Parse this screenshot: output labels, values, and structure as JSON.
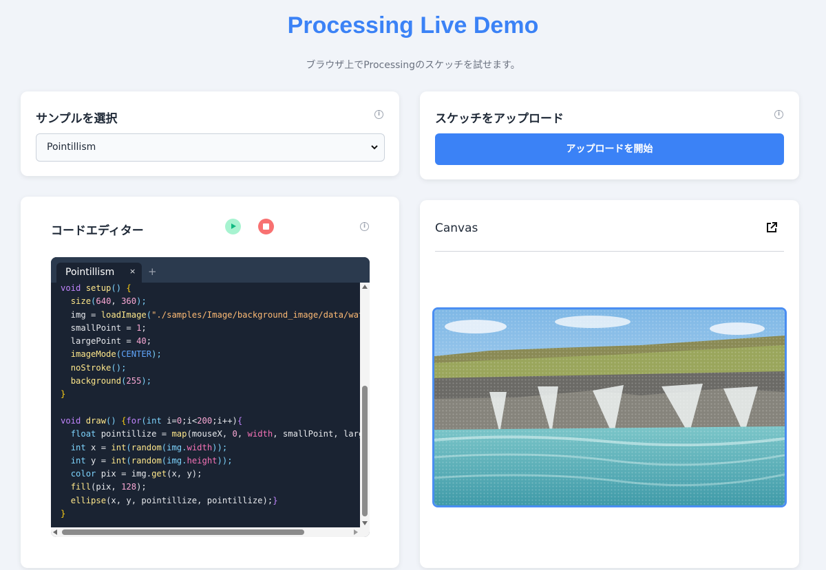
{
  "header": {
    "title": "Processing Live Demo",
    "subtitle": "ブラウザ上でProcessingのスケッチを試せます。"
  },
  "sample_card": {
    "title": "サンプルを選択",
    "selected": "Pointillism"
  },
  "upload_card": {
    "title": "スケッチをアップロード",
    "button_label": "アップロードを開始"
  },
  "editor_card": {
    "title": "コードエディター",
    "tab_label": "Pointillism",
    "tab_close": "×",
    "tab_add": "+"
  },
  "canvas_card": {
    "title": "Canvas"
  },
  "code": [
    [
      [
        "void ",
        "kw"
      ],
      [
        "setup",
        "fn"
      ],
      [
        "() ",
        "ty"
      ],
      [
        "{",
        "br"
      ]
    ],
    [
      [
        "  "
      ],
      [
        "size",
        "fn"
      ],
      [
        "(",
        "ty"
      ],
      [
        "640",
        "num"
      ],
      [
        ", "
      ],
      [
        "360",
        "num"
      ],
      [
        ");",
        "ty"
      ]
    ],
    [
      [
        "  img = "
      ],
      [
        "loadImage",
        "fn"
      ],
      [
        "(",
        "ty"
      ],
      [
        "\"./samples/Image/background_image/data/water",
        "str"
      ]
    ],
    [
      [
        "  smallPoint = "
      ],
      [
        "1",
        "num"
      ],
      [
        ";"
      ]
    ],
    [
      [
        "  largePoint = "
      ],
      [
        "40",
        "num"
      ],
      [
        ";"
      ]
    ],
    [
      [
        "  "
      ],
      [
        "imageMode",
        "fn"
      ],
      [
        "(",
        "ty"
      ],
      [
        "CENTER",
        "cn"
      ],
      [
        ");",
        "ty"
      ]
    ],
    [
      [
        "  "
      ],
      [
        "noStroke",
        "fn"
      ],
      [
        "();",
        "ty"
      ]
    ],
    [
      [
        "  "
      ],
      [
        "background",
        "fn"
      ],
      [
        "(",
        "ty"
      ],
      [
        "255",
        "num"
      ],
      [
        ");",
        "ty"
      ]
    ],
    [
      [
        "}",
        "br"
      ]
    ],
    [
      [
        ""
      ]
    ],
    [
      [
        "void ",
        "kw"
      ],
      [
        "draw",
        "fn"
      ],
      [
        "() ",
        "ty"
      ],
      [
        "{",
        "br"
      ],
      [
        "for",
        "kw"
      ],
      [
        "(",
        "ty"
      ],
      [
        "int ",
        "ty"
      ],
      [
        "i=",
        ""
      ],
      [
        "0",
        "num"
      ],
      [
        ";i<"
      ],
      [
        "200",
        "num"
      ],
      [
        ";i++)"
      ],
      [
        "{",
        "kw"
      ]
    ],
    [
      [
        "  "
      ],
      [
        "float ",
        "ty"
      ],
      [
        "pointillize = "
      ],
      [
        "map",
        "fn"
      ],
      [
        "(mouseX, "
      ],
      [
        "0",
        "num"
      ],
      [
        ", "
      ],
      [
        "width",
        "pr"
      ],
      [
        ", smallPoint, largeP"
      ]
    ],
    [
      [
        "  "
      ],
      [
        "int ",
        "ty"
      ],
      [
        "x = "
      ],
      [
        "int",
        "fn"
      ],
      [
        "(",
        "ty"
      ],
      [
        "random",
        "fn"
      ],
      [
        "(img.",
        "ty"
      ],
      [
        "width",
        "pr"
      ],
      [
        "));",
        "ty"
      ]
    ],
    [
      [
        "  "
      ],
      [
        "int ",
        "ty"
      ],
      [
        "y = "
      ],
      [
        "int",
        "fn"
      ],
      [
        "(",
        "ty"
      ],
      [
        "random",
        "fn"
      ],
      [
        "(img.",
        "ty"
      ],
      [
        "height",
        "pr"
      ],
      [
        "));",
        "ty"
      ]
    ],
    [
      [
        "  "
      ],
      [
        "color ",
        "ty"
      ],
      [
        "pix = img."
      ],
      [
        "get",
        "fn"
      ],
      [
        "(x, y);"
      ]
    ],
    [
      [
        "  "
      ],
      [
        "fill",
        "fn"
      ],
      [
        "(pix, "
      ],
      [
        "128",
        "num"
      ],
      [
        ");"
      ]
    ],
    [
      [
        "  "
      ],
      [
        "ellipse",
        "fn"
      ],
      [
        "(x, y, pointillize, pointillize);"
      ],
      [
        "}",
        "kw"
      ]
    ],
    [
      [
        "}",
        "br"
      ]
    ]
  ],
  "colors": {
    "accent": "#3b82f6",
    "play": "#a7f3d0",
    "stop": "#f87171",
    "editor_bg": "#1a2332"
  }
}
